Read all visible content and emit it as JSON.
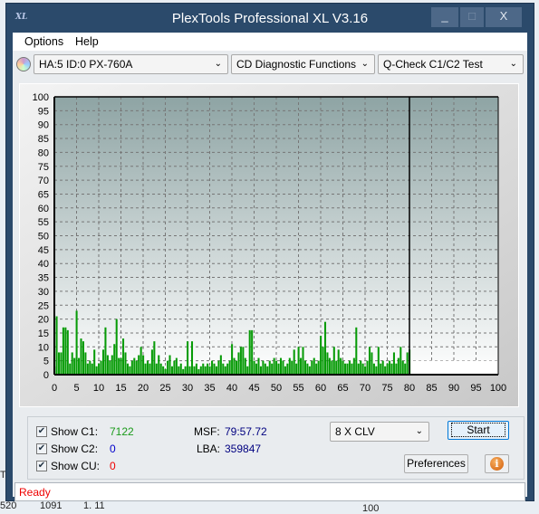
{
  "window": {
    "title": "PlexTools Professional XL V3.16",
    "logo": "XL",
    "minimize": "_",
    "maximize": "□",
    "close": "X"
  },
  "menu": {
    "options": "Options",
    "help": "Help"
  },
  "toolbar": {
    "drive": "HA:5 ID:0  PX-760A",
    "function": "CD Diagnostic Functions",
    "test": "Q-Check C1/C2 Test",
    "drive_icon": "cd-disc-icon"
  },
  "chart_data": {
    "type": "bar",
    "title": "",
    "xlabel": "",
    "ylabel": "",
    "xlim": [
      0,
      100
    ],
    "ylim": [
      0,
      100
    ],
    "grid": true,
    "x_ticks": [
      0,
      5,
      10,
      15,
      20,
      25,
      30,
      35,
      40,
      45,
      50,
      55,
      60,
      65,
      70,
      75,
      80,
      85,
      90,
      95,
      100
    ],
    "y_ticks": [
      0,
      5,
      10,
      15,
      20,
      25,
      30,
      35,
      40,
      45,
      50,
      55,
      60,
      65,
      70,
      75,
      80,
      85,
      90,
      95,
      100
    ],
    "end_marker": 80,
    "bar_color": "#079b07",
    "x_step": 0.5,
    "values": [
      3,
      21,
      8,
      8,
      17,
      17,
      16,
      4,
      8,
      6,
      23,
      6,
      13,
      12,
      8,
      4,
      5,
      4,
      9,
      3,
      4,
      5,
      9,
      17,
      7,
      5,
      7,
      11,
      20,
      6,
      6,
      13,
      8,
      4,
      3,
      5,
      6,
      5,
      7,
      10,
      7,
      4,
      5,
      4,
      9,
      12,
      4,
      7,
      4,
      3,
      2,
      5,
      7,
      3,
      5,
      6,
      3,
      4,
      2,
      3,
      12,
      3,
      12,
      3,
      4,
      2,
      3,
      4,
      3,
      4,
      3,
      5,
      4,
      3,
      5,
      7,
      4,
      3,
      4,
      5,
      11,
      6,
      5,
      8,
      10,
      10,
      6,
      3,
      16,
      16,
      5,
      4,
      6,
      3,
      5,
      4,
      3,
      5,
      4,
      6,
      5,
      4,
      6,
      5,
      3,
      4,
      6,
      5,
      9,
      4,
      10,
      6,
      10,
      5,
      4,
      3,
      5,
      6,
      4,
      5,
      14,
      10,
      19,
      8,
      6,
      5,
      10,
      5,
      9,
      6,
      5,
      4,
      4,
      5,
      4,
      6,
      17,
      4,
      5,
      4,
      3,
      5,
      10,
      8,
      4,
      3,
      10,
      4,
      5,
      3,
      4,
      5,
      4,
      8,
      4,
      6,
      10,
      5,
      4,
      8,
      9
    ]
  },
  "panel": {
    "show_c1": "Show C1:",
    "c1_value": "7122",
    "show_c2": "Show C2:",
    "c2_value": "0",
    "show_cu": "Show CU:",
    "cu_value": "0",
    "msf_label": "MSF:",
    "msf_value": "79:57.72",
    "lba_label": "LBA:",
    "lba_value": "359847",
    "speed": "8 X CLV",
    "start": "Start",
    "preferences": "Preferences",
    "info_icon": "info-icon",
    "colors": {
      "c1": "#1a9a1a",
      "c2": "#0000cc",
      "cu": "#ee0000",
      "msf": "#000080"
    }
  },
  "status": "Ready",
  "background": {
    "t": "T",
    "n1": "520",
    "n2": "1091",
    "n3": "1. 11",
    "n4": "100"
  }
}
